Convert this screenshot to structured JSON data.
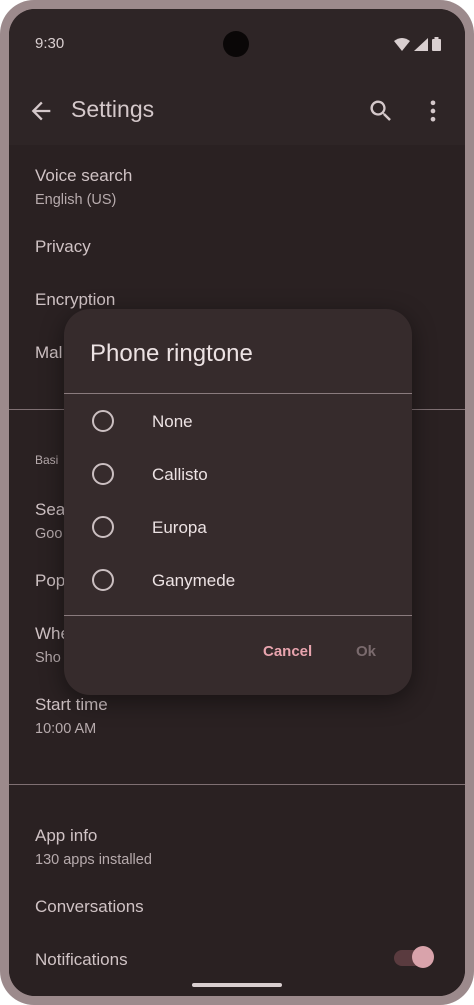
{
  "status_bar": {
    "time": "9:30"
  },
  "app_bar": {
    "title": "Settings"
  },
  "settings": [
    {
      "title": "Voice search",
      "subtitle": "English (US)"
    },
    {
      "title": "Privacy"
    },
    {
      "title": "Encryption"
    },
    {
      "title": "Mal"
    }
  ],
  "section2": {
    "label": "Basi",
    "items": [
      {
        "title": "Sea",
        "subtitle": "Goo"
      },
      {
        "title": "Pop"
      },
      {
        "title": "Whe",
        "subtitle": "Sho"
      },
      {
        "title": "Start time",
        "subtitle": "10:00 AM"
      }
    ]
  },
  "section3": {
    "items": [
      {
        "title": "App info",
        "subtitle": "130 apps installed"
      },
      {
        "title": "Conversations"
      },
      {
        "title": "Notifications",
        "toggle_on": true
      }
    ]
  },
  "dialog": {
    "title": "Phone ringtone",
    "options": [
      "None",
      "Callisto",
      "Europa",
      "Ganymede"
    ],
    "cancel_label": "Cancel",
    "ok_label": "Ok",
    "selected": null
  },
  "colors": {
    "accent": "#e8a4ae",
    "surface": "#2a2122",
    "dialog": "#362b2c"
  }
}
